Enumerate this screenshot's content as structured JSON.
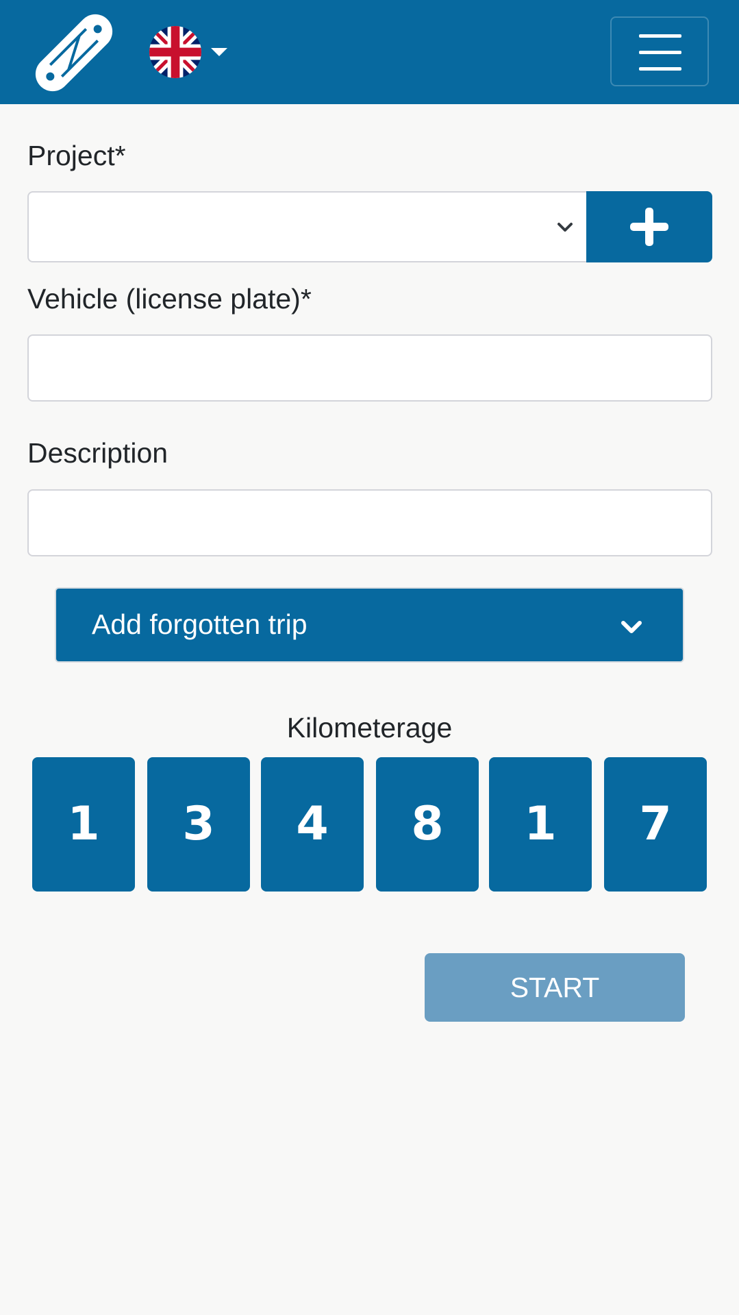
{
  "header": {
    "logo_icon": "app-logo-icon",
    "language_flag": "united-kingdom-flag-icon",
    "menu_icon": "hamburger-menu-icon",
    "brand_color": "#07699f"
  },
  "form": {
    "project_label": "Project*",
    "project_value": "",
    "add_project_icon": "plus-icon",
    "vehicle_label": "Vehicle (license plate)*",
    "vehicle_value": "",
    "description_label": "Description",
    "description_value": ""
  },
  "forgotten_trip": {
    "label": "Add forgotten trip",
    "icon": "chevron-down-icon"
  },
  "kilometerage": {
    "title": "Kilometerage",
    "digits": [
      "1",
      "3",
      "4",
      "8",
      "1",
      "7"
    ]
  },
  "actions": {
    "start_label": "START",
    "start_color": "#6a9ec2"
  }
}
